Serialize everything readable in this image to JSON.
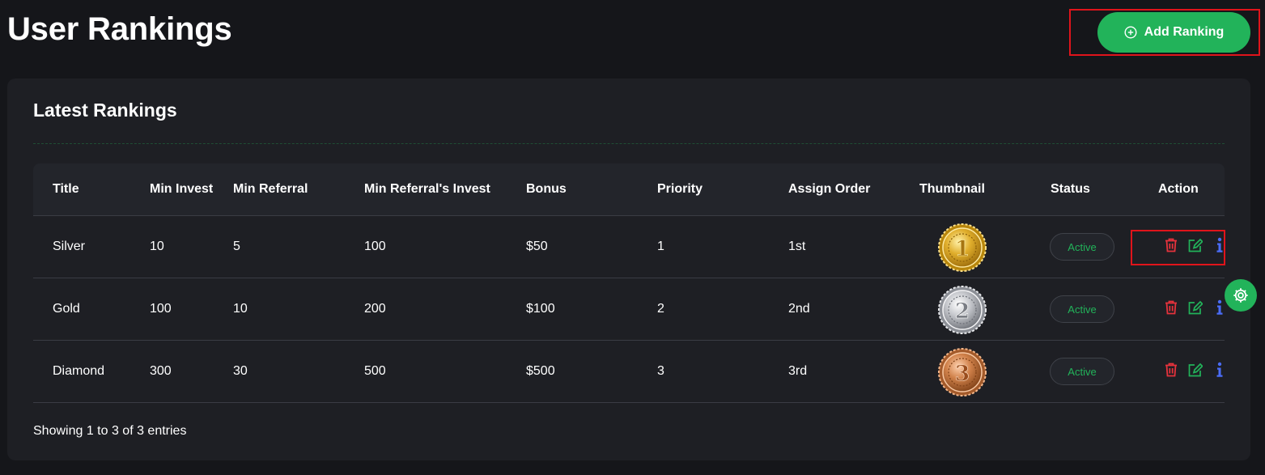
{
  "header": {
    "title": "User Rankings",
    "add_button_label": "Add Ranking",
    "add_button_icon": "plus-circle-icon"
  },
  "card": {
    "title": "Latest Rankings",
    "footer": "Showing 1 to 3 of 3 entries"
  },
  "table": {
    "columns": [
      "Title",
      "Min Invest",
      "Min Referral",
      "Min Referral's Invest",
      "Bonus",
      "Priority",
      "Assign Order",
      "Thumbnail",
      "Status",
      "Action"
    ],
    "rows": [
      {
        "title": "Silver",
        "min_invest": "10",
        "min_referral": "5",
        "min_referral_invest": "100",
        "bonus": "$50",
        "priority": "1",
        "assign_order": "1st",
        "thumbnail": "gold-medal-1",
        "status": "Active"
      },
      {
        "title": "Gold",
        "min_invest": "100",
        "min_referral": "10",
        "min_referral_invest": "200",
        "bonus": "$100",
        "priority": "2",
        "assign_order": "2nd",
        "thumbnail": "silver-medal-2",
        "status": "Active"
      },
      {
        "title": "Diamond",
        "min_invest": "300",
        "min_referral": "30",
        "min_referral_invest": "500",
        "bonus": "$500",
        "priority": "3",
        "assign_order": "3rd",
        "thumbnail": "bronze-medal-3",
        "status": "Active"
      }
    ],
    "medal_numbers": [
      "1",
      "2",
      "3"
    ]
  },
  "colors": {
    "background": "#15161a",
    "card": "#1e1f24",
    "accent_green": "#22b35a",
    "delete_red": "#e5323c",
    "edit_green": "#22b35a",
    "info_blue": "#4a6cf7",
    "highlight_red": "#e0141b"
  },
  "icons": {
    "delete": "trash-icon",
    "edit": "edit-icon",
    "info": "info-icon",
    "settings": "gear-icon"
  }
}
